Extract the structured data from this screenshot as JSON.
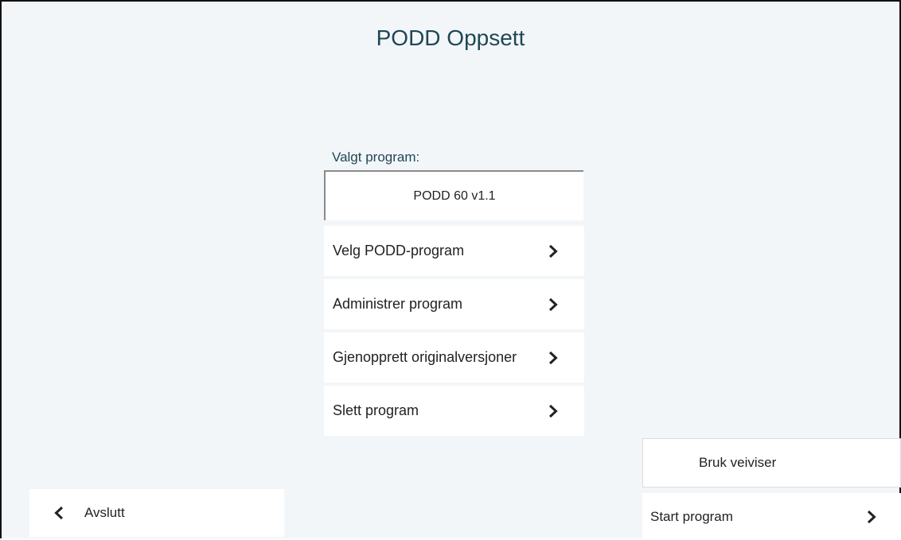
{
  "header": {
    "title": "PODD Oppsett"
  },
  "selected": {
    "label": "Valgt program:",
    "value": "PODD 60 v1.1"
  },
  "menu": [
    {
      "label": "Velg PODD-program"
    },
    {
      "label": "Administrer program"
    },
    {
      "label": "Gjenopprett originalversjoner"
    },
    {
      "label": "Slett program"
    }
  ],
  "footer": {
    "exit_label": "Avslutt",
    "wizard_label": "Bruk veiviser",
    "start_label": "Start program"
  },
  "colors": {
    "background": "#f3f6f9",
    "title": "#1f4756",
    "panel": "#ffffff"
  },
  "icons": {
    "chevron_right": "chevron-right-icon",
    "chevron_left": "chevron-left-icon"
  }
}
